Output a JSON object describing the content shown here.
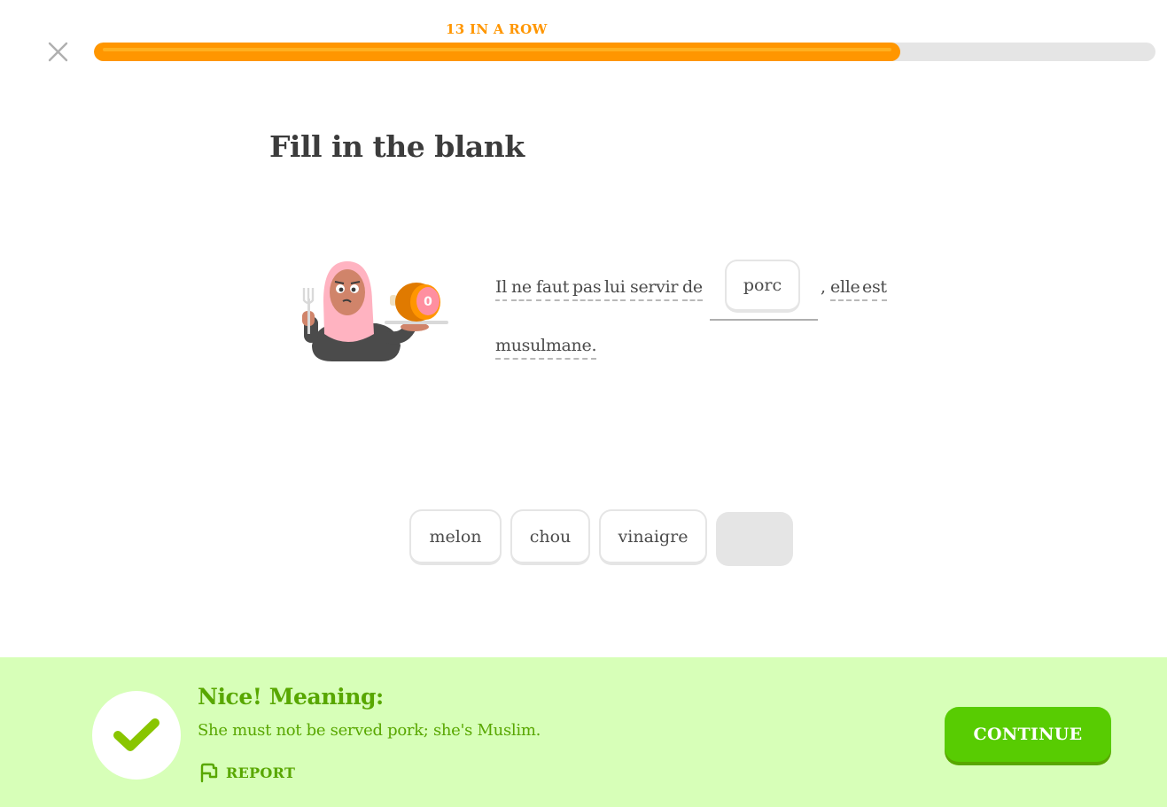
{
  "header": {
    "close_icon": "close-icon",
    "streak_label": "13 IN A ROW",
    "progress_fraction": 0.76,
    "colors": {
      "streak": "#ff9600",
      "progress_fill": "#ff9600",
      "progress_track": "#e5e5e5"
    }
  },
  "challenge": {
    "title": "Fill in the blank",
    "character_icon": "woman-with-hijab-holding-ham-icon",
    "character_badge": "0",
    "sentence": {
      "word_1": "Il",
      "word_2": "ne",
      "word_3": "faut",
      "word_4": "pas",
      "word_5": "lui",
      "word_6": "servir",
      "word_7": "de",
      "blank_answer": "porc",
      "comma": ",",
      "word_8": "elle",
      "word_9": "est",
      "word_10": "musulmane."
    },
    "word_bank": [
      {
        "label": "melon"
      },
      {
        "label": "chou"
      },
      {
        "label": "vinaigre"
      }
    ]
  },
  "feedback": {
    "status_icon": "checkmark-icon",
    "title": "Nice! Meaning:",
    "meaning": "She must not be served pork; she's Muslim.",
    "report_icon": "flag-icon",
    "report_label": "REPORT",
    "continue_label": "CONTINUE",
    "colors": {
      "background": "#d7ffb8",
      "text": "#58a700",
      "button": "#58cc02"
    }
  }
}
